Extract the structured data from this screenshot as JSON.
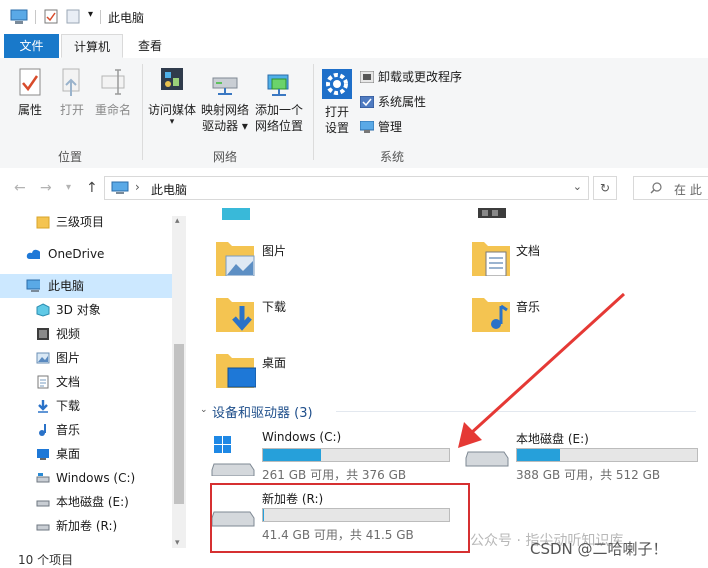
{
  "window": {
    "title": "此电脑"
  },
  "ribbon_tabs": [
    {
      "label": "文件"
    },
    {
      "label": "计算机"
    },
    {
      "label": "查看"
    }
  ],
  "ribbon": {
    "location_group": {
      "label": "位置",
      "properties": "属性",
      "open": "打开",
      "rename": "重命名"
    },
    "network_group": {
      "label": "网络",
      "access_media": "访问媒体",
      "map_drive": [
        "映射网络",
        "驱动器"
      ],
      "add_location": [
        "添加一个",
        "网络位置"
      ]
    },
    "system_group": {
      "label": "系统",
      "open_settings": [
        "打开",
        "设置"
      ],
      "uninstall": "卸载或更改程序",
      "system_properties": "系统属性",
      "manage": "管理"
    }
  },
  "address_bar": {
    "path": "此电脑",
    "search_placeholder": "在 此"
  },
  "nav_pane": {
    "items": [
      {
        "label": "三级项目",
        "icon": "folder-icon"
      },
      {
        "label": "OneDrive",
        "icon": "cloud-icon"
      },
      {
        "label": "此电脑",
        "icon": "computer-icon",
        "selected": true
      },
      {
        "label": "3D 对象",
        "icon": "cube-icon"
      },
      {
        "label": "视频",
        "icon": "video-icon"
      },
      {
        "label": "图片",
        "icon": "picture-icon"
      },
      {
        "label": "文档",
        "icon": "document-icon"
      },
      {
        "label": "下载",
        "icon": "download-icon"
      },
      {
        "label": "音乐",
        "icon": "music-icon"
      },
      {
        "label": "桌面",
        "icon": "desktop-icon"
      },
      {
        "label": "Windows (C:)",
        "icon": "drive-icon"
      },
      {
        "label": "本地磁盘 (E:)",
        "icon": "drive-icon"
      },
      {
        "label": "新加卷 (R:)",
        "icon": "drive-icon"
      }
    ]
  },
  "folders": [
    {
      "label": "图片",
      "icon": "picture-folder-icon"
    },
    {
      "label": "文档",
      "icon": "document-folder-icon"
    },
    {
      "label": "下载",
      "icon": "download-folder-icon"
    },
    {
      "label": "音乐",
      "icon": "music-folder-icon"
    },
    {
      "label": "桌面",
      "icon": "desktop-folder-icon"
    }
  ],
  "devices_section": {
    "title": "设备和驱动器 (3)"
  },
  "drives": [
    {
      "name": "Windows (C:)",
      "free": "261 GB 可用，共 376 GB",
      "used_fraction": 0.31
    },
    {
      "name": "本地磁盘 (E:)",
      "free": "388 GB 可用，共 512 GB",
      "used_fraction": 0.24
    },
    {
      "name": "新加卷 (R:)",
      "free": "41.4 GB 可用，共 41.5 GB",
      "used_fraction": 0.003
    }
  ],
  "status_bar": {
    "text": "10 个项目"
  },
  "watermark": {
    "text": "公众号 · 指尖动听知识库",
    "csdn": "CSDN @二哈喇子！"
  },
  "colors": {
    "accent": "#1979ca",
    "drive_fill": "#26a0da",
    "highlight": "#d63031",
    "arrow": "#e53935"
  }
}
